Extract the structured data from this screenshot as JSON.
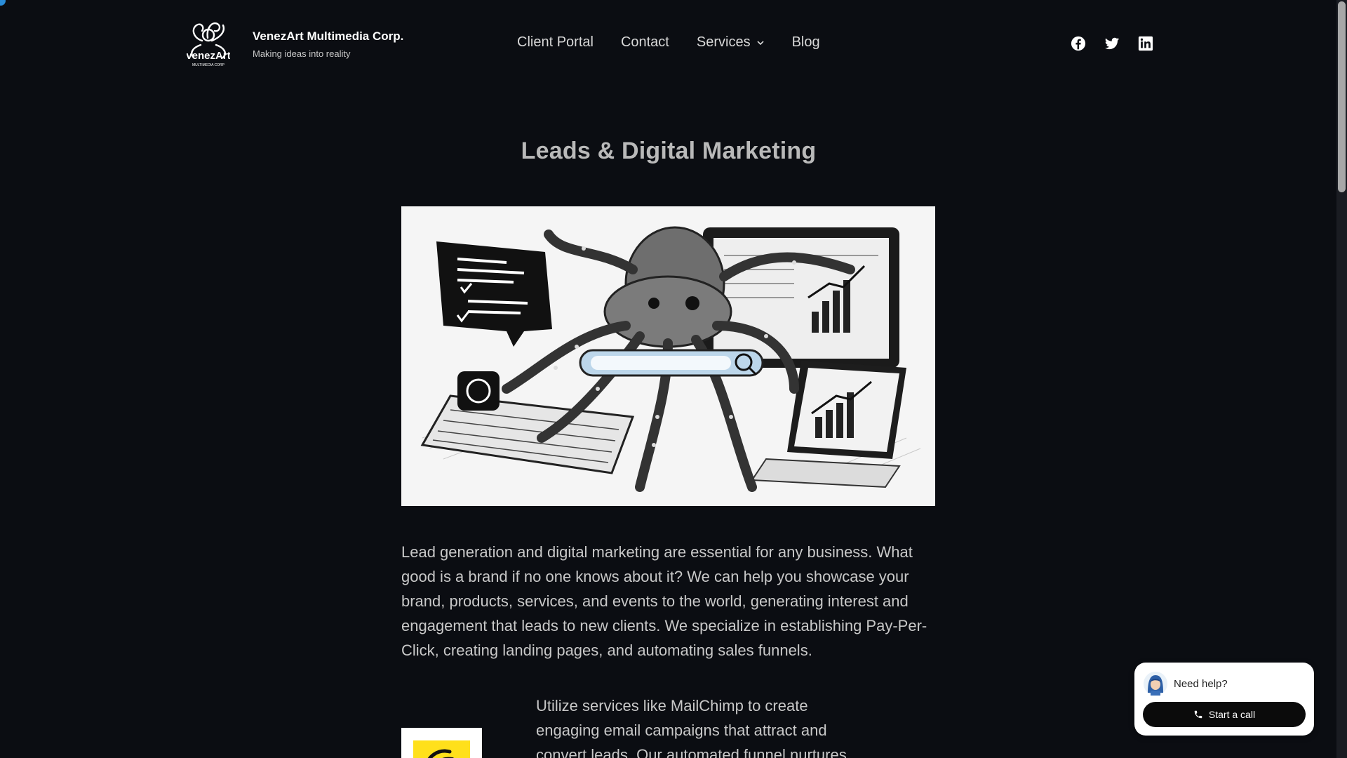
{
  "header": {
    "brand_name": "VenezArt Multimedia Corp.",
    "brand_tagline": "Making ideas into reality",
    "nav": [
      {
        "label": "Client Portal"
      },
      {
        "label": "Contact"
      },
      {
        "label": "Services",
        "has_dropdown": true
      },
      {
        "label": "Blog"
      }
    ],
    "social_icons": [
      "facebook-icon",
      "twitter-icon",
      "linkedin-icon"
    ]
  },
  "main": {
    "title": "Leads & Digital Marketing",
    "intro": "Lead generation and digital marketing are essential for any business. What good is a brand if no one knows about it? We can help you showcase your brand, products, services, and events to the world, generating interest and engagement that leads to new clients. We specialize in establishing Pay-Per-Click, creating landing pages, and automating sales funnels.",
    "mailchimp_text": "Utilize services like MailChimp to create engaging email campaigns that attract and convert leads. Our automated funnel nurtures"
  },
  "chat": {
    "help_label": "Need help?",
    "call_button": "Start a call"
  },
  "colors": {
    "background": "#0b0d12",
    "title": "#b9b9b9",
    "body_text": "#c8c8c8",
    "mailchimp_yellow": "#ffe01b"
  }
}
